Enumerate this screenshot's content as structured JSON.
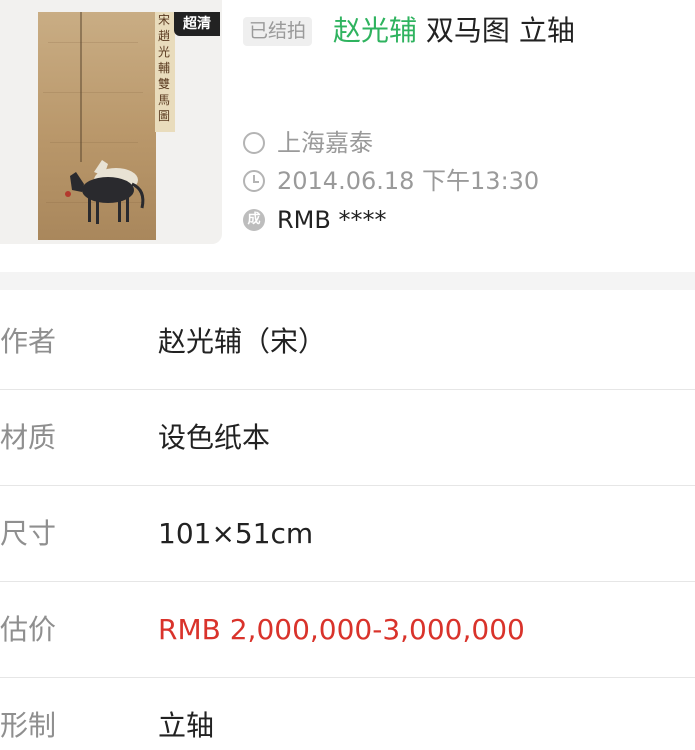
{
  "header": {
    "thumbnail": {
      "badge": "超清",
      "inscription": "宋趙光輔雙馬圖"
    },
    "status_tag": "已结拍",
    "artist": "赵光辅",
    "work_title": "双马图 立轴",
    "auction_house": "上海嘉泰",
    "datetime": "2014.06.18 下午13:30",
    "deal_icon_char": "成",
    "deal_price": "RMB ****"
  },
  "details": [
    {
      "label": "作者",
      "value": "赵光辅（宋）"
    },
    {
      "label": "材质",
      "value": "设色纸本"
    },
    {
      "label": "尺寸",
      "value": "101×51cm"
    },
    {
      "label": "估价",
      "value": "RMB  2,000,000-3,000,000"
    },
    {
      "label": "形制",
      "value": "立轴"
    }
  ],
  "colors": {
    "artist_green": "#2fb35f",
    "estimate_red": "#d9332b",
    "label_gray": "#8f8f8f"
  }
}
